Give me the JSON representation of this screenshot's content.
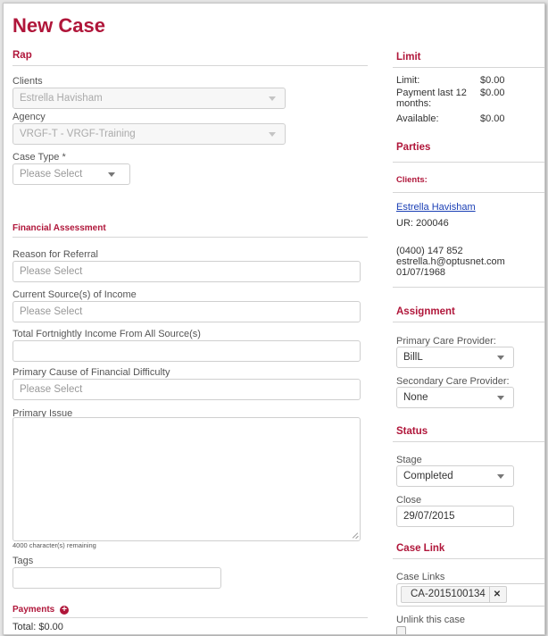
{
  "page_title": "New Case",
  "rap": {
    "title": "Rap",
    "clients_label": "Clients",
    "clients_value": "Estrella Havisham",
    "agency_label": "Agency",
    "agency_value": "VRGF-T - VRGF-Training",
    "case_type_label": "Case Type *",
    "case_type_value": "Please Select"
  },
  "financial": {
    "title": "Financial Assessment",
    "reason_label": "Reason for Referral",
    "reason_value": "Please Select",
    "income_source_label": "Current Source(s) of Income",
    "income_source_value": "Please Select",
    "fortnightly_label": "Total Fortnightly Income From All Source(s)",
    "fortnightly_value": "",
    "cause_label": "Primary Cause of Financial Difficulty",
    "cause_value": "Please Select",
    "issue_label": "Primary Issue",
    "remaining": "4000 character(s) remaining",
    "tags_label": "Tags",
    "tags_value": ""
  },
  "payments": {
    "title": "Payments",
    "add_icon": "plus-circle-icon",
    "total": "Total: $0.00"
  },
  "limit": {
    "title": "Limit",
    "rows": [
      {
        "label": "Limit:",
        "value": "$0.00"
      },
      {
        "label": "Payment last 12 months:",
        "value": "$0.00"
      },
      {
        "label": "Available:",
        "value": "$0.00"
      }
    ]
  },
  "parties": {
    "title": "Parties",
    "clients_heading": "Clients:",
    "client_name": "Estrella Havisham",
    "ur": "UR: 200046",
    "phone": "(0400) 147 852",
    "email": "estrella.h@optusnet.com",
    "dob": "01/07/1968"
  },
  "assignment": {
    "title": "Assignment",
    "primary_label": "Primary Care Provider:",
    "primary_value": "BillL",
    "secondary_label": "Secondary Care Provider:",
    "secondary_value": "None"
  },
  "status": {
    "title": "Status",
    "stage_label": "Stage",
    "stage_value": "Completed",
    "close_label": "Close",
    "close_value": "29/07/2015"
  },
  "case_link": {
    "title": "Case Link",
    "links_label": "Case Links",
    "link_tag": "CA-2015100134",
    "remove_icon": "close-icon",
    "unlink_label": "Unlink this case"
  },
  "colors": {
    "accent": "#b0163a",
    "link": "#1a3fb5"
  }
}
